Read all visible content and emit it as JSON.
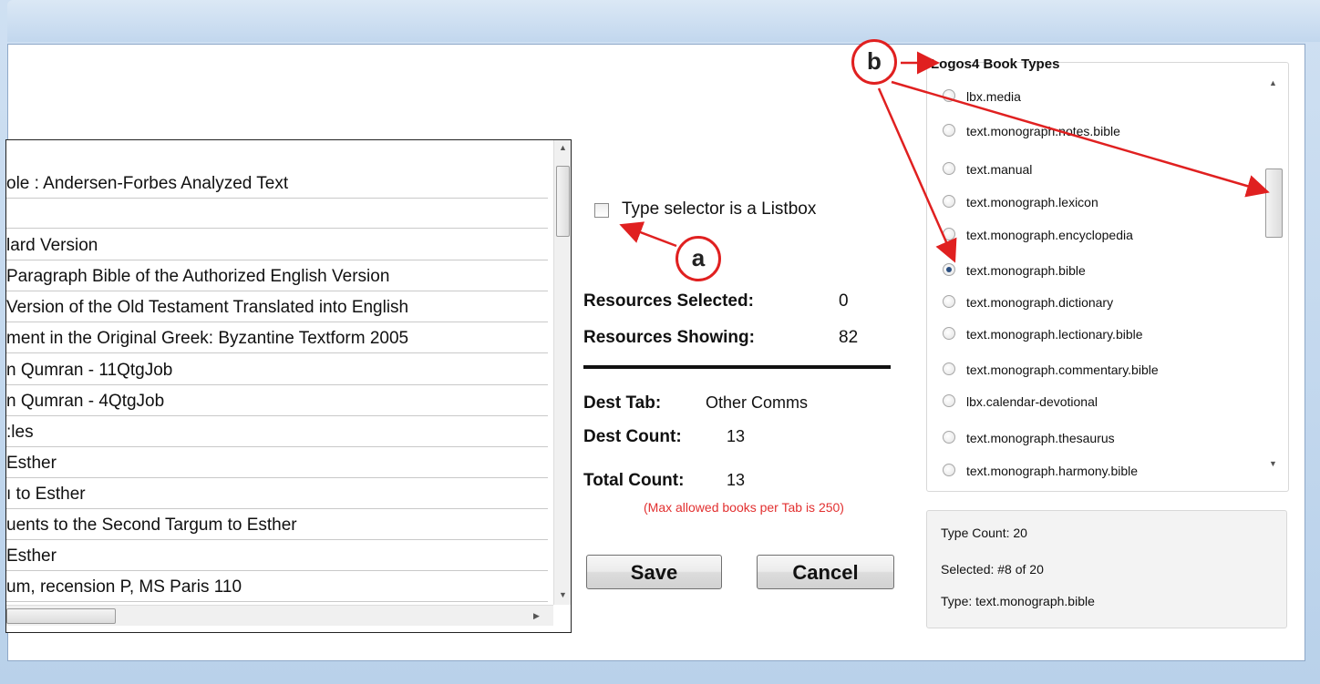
{
  "list": {
    "rows": [
      "ole : Andersen-Forbes Analyzed Text",
      "",
      "lard Version",
      " Paragraph Bible of the Authorized English Version",
      " Version of the Old Testament Translated into English",
      "ment in the Original Greek: Byzantine Textform 2005",
      "n Qumran - 11QtgJob",
      "n Qumran - 4QtgJob",
      ":les",
      " Esther",
      "ı to Esther",
      "uents to the Second Targum to Esther",
      " Esther",
      "um, recension P, MS Paris 110"
    ]
  },
  "options": {
    "listbox_checkbox_label": "Type selector is a Listbox",
    "listbox_checked": false
  },
  "stats": {
    "resources_selected_label": "Resources Selected:",
    "resources_selected_value": "0",
    "resources_showing_label": "Resources Showing:",
    "resources_showing_value": "82",
    "dest_tab_label": "Dest Tab:",
    "dest_tab_value": "Other Comms",
    "dest_count_label": "Dest Count:",
    "dest_count_value": "13",
    "total_count_label": "Total Count:",
    "total_count_value": "13",
    "max_note": "(Max allowed books per Tab is 250)"
  },
  "buttons": {
    "save": "Save",
    "cancel": "Cancel"
  },
  "book_types": {
    "title": "Logos4 Book Types",
    "items": [
      "lbx.media",
      "text.monograph.notes.bible",
      "text.manual",
      "text.monograph.lexicon",
      "text.monograph.encyclopedia",
      "text.monograph.bible",
      "text.monograph.dictionary",
      "text.monograph.lectionary.bible",
      "text.monograph.commentary.bible",
      "lbx.calendar-devotional",
      "text.monograph.thesaurus",
      "text.monograph.harmony.bible"
    ],
    "selected_index": 5
  },
  "info": {
    "type_count": "Type Count: 20",
    "selected": "Selected: #8 of 20",
    "type": "Type: text.monograph.bible"
  },
  "annotations": {
    "a": "a",
    "b": "b",
    "color": "#e02020"
  }
}
